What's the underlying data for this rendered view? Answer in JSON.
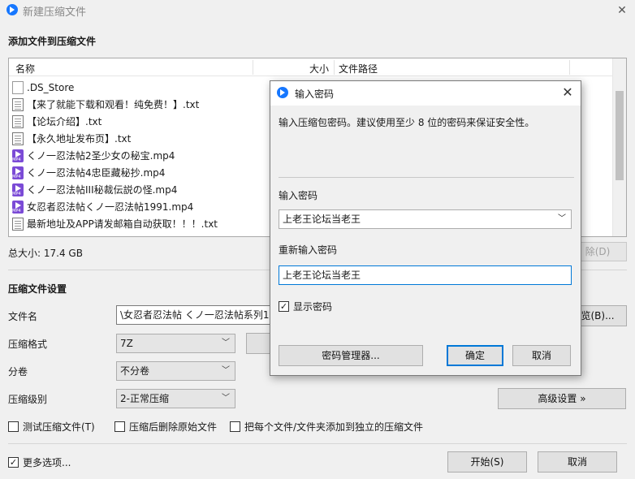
{
  "window": {
    "title": "新建压缩文件"
  },
  "add_section": {
    "title": "添加文件到压缩文件"
  },
  "file_list": {
    "columns": [
      "名称",
      "大小",
      "文件路径"
    ],
    "files": [
      {
        "name": ".DS_Store",
        "icon": "doc-icon"
      },
      {
        "name": "【来了就能下载和观看！纯免费！】.txt",
        "icon": "txt-icon"
      },
      {
        "name": "【论坛介绍】.txt",
        "icon": "txt-icon"
      },
      {
        "name": "【永久地址发布页】.txt",
        "icon": "txt-icon"
      },
      {
        "name": "くノ一忍法帖2圣少女の秘宝.mp4",
        "icon": "mp4-icon"
      },
      {
        "name": "くノ一忍法帖4忠臣藏秘抄.mp4",
        "icon": "mp4-icon"
      },
      {
        "name": "くノ一忍法帖III秘裁伝説の怪.mp4",
        "icon": "mp4-icon"
      },
      {
        "name": "女忍者忍法帖くノ一忍法帖1991.mp4",
        "icon": "mp4-icon"
      },
      {
        "name": "最新地址及APP请发邮箱自动获取！！！.txt",
        "icon": "txt-icon"
      }
    ]
  },
  "total_size": "总大小: 17.4 GB",
  "delete_button": "除(D)",
  "settings": {
    "title": "压缩文件设置",
    "filename_label": "文件名",
    "filename_value": "\\女忍者忍法帖 くノ一忍法帖系列1-",
    "browse_button": "览(B)...",
    "format_label": "压缩格式",
    "format_value": "7Z",
    "split_label": "分卷",
    "split_value": "不分卷",
    "level_label": "压缩级别",
    "level_value": "2-正常压缩",
    "advanced_button": "高级设置 »",
    "test_cb": "测试压缩文件(T)",
    "delete_after_cb": "压缩后删除原始文件",
    "separate_cb": "把每个文件/文件夹添加到独立的压缩文件",
    "more_options_cb": "更多选项..."
  },
  "footer": {
    "start_button": "开始(S)",
    "cancel_button": "取消"
  },
  "dialog": {
    "title": "输入密码",
    "description": "输入压缩包密码。建议使用至少 8 位的密码来保证安全性。",
    "pw_label": "输入密码",
    "pw_value": "上老王论坛当老王",
    "pw2_label": "重新输入密码",
    "pw2_value": "上老王论坛当老王",
    "show_pw_cb": "显示密码",
    "manager_button": "密码管理器...",
    "ok_button": "确定",
    "cancel_button": "取消"
  },
  "colors": {
    "accent": "#0078d7",
    "mp4_icon": "#7b4bd6",
    "app_icon": "#1677ff"
  }
}
